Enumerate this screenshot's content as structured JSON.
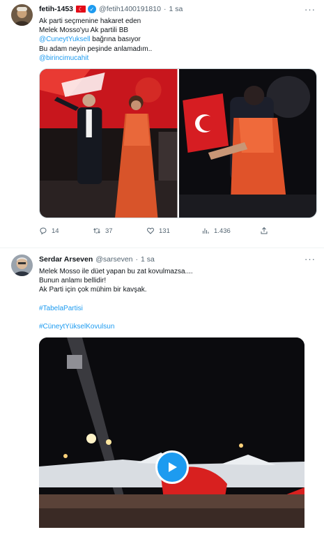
{
  "tweets": [
    {
      "name": "fetih-1453",
      "handle": "@fetih1400191810",
      "time": "1 sa",
      "text": {
        "line1": "Ak parti seçmenine hakaret eden",
        "line2": "Melek Mosso'yu Ak partili BB",
        "mention1": "@CuneytYuksell",
        "line3_rest": " bağrına basıyor",
        "line4": "Bu adam neyin peşinde anlamadım..",
        "mention2": "@birincimucahit"
      },
      "actions": {
        "replies": "14",
        "retweets": "37",
        "likes": "131",
        "views": "1.436"
      }
    },
    {
      "name": "Serdar Arseven",
      "handle": "@sarseven",
      "time": "1 sa",
      "text": {
        "line1": "Melek Mosso ile düet yapan bu zat kovulmazsa....",
        "line2": "Bunun anlamı bellidir!",
        "line3": "Ak Parti için çok mühim bir kavşak.",
        "hashtag1": "#TabelaPartisi",
        "hashtag2": "#CüneytYükselKovulsun"
      }
    }
  ],
  "colors": {
    "link": "#1d9bf0",
    "secondary_text": "#536471",
    "divider": "#eff3f4"
  },
  "icons": [
    "more-icon",
    "turkey-flag-icon",
    "verified-badge-icon",
    "reply-icon",
    "retweet-icon",
    "like-icon",
    "views-icon",
    "share-icon",
    "play-icon"
  ]
}
